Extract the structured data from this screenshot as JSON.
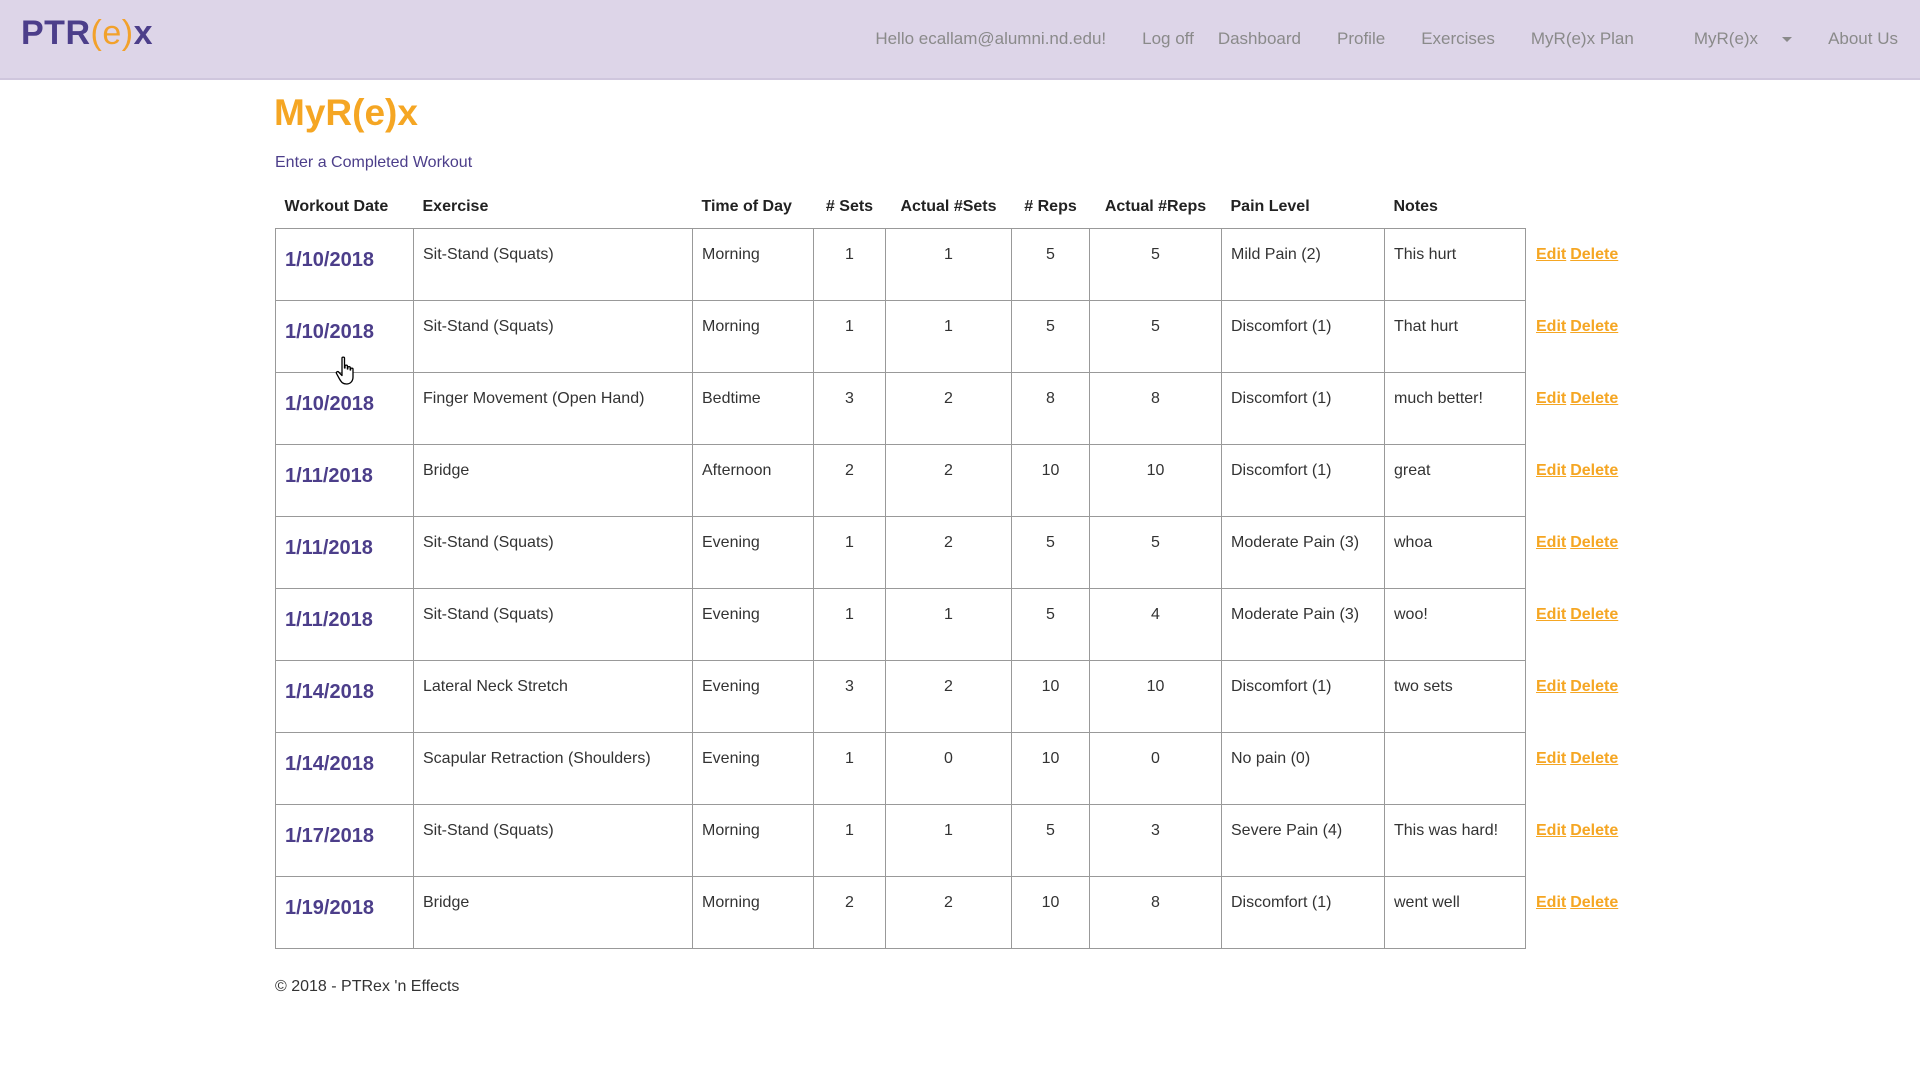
{
  "nav": {
    "brand_prefix": "PTR",
    "brand_accent": "(e)",
    "brand_suffix": "x",
    "greeting": "Hello ecallam@alumni.nd.edu!",
    "logoff": "Log off",
    "dashboard": "Dashboard",
    "profile": "Profile",
    "exercises": "Exercises",
    "plan": "MyR(e)x Plan",
    "myrex": "MyR(e)x",
    "about": "About Us"
  },
  "page": {
    "title": "MyR(e)x",
    "subtitle": "Enter a Completed Workout"
  },
  "table": {
    "headers": {
      "date": "Workout Date",
      "exercise": "Exercise",
      "time": "Time of Day",
      "sets": "# Sets",
      "actual_sets": "Actual #Sets",
      "reps": "# Reps",
      "actual_reps": "Actual #Reps",
      "pain": "Pain Level",
      "notes": "Notes"
    },
    "edit_label": "Edit",
    "delete_label": "Delete",
    "rows": [
      {
        "date": "1/10/2018",
        "exercise": "Sit-Stand (Squats)",
        "time": "Morning",
        "sets": "1",
        "actual_sets": "1",
        "reps": "5",
        "actual_reps": "5",
        "pain": "Mild Pain (2)",
        "notes": "This hurt"
      },
      {
        "date": "1/10/2018",
        "exercise": "Sit-Stand (Squats)",
        "time": "Morning",
        "sets": "1",
        "actual_sets": "1",
        "reps": "5",
        "actual_reps": "5",
        "pain": "Discomfort (1)",
        "notes": "That hurt"
      },
      {
        "date": "1/10/2018",
        "exercise": "Finger Movement (Open Hand)",
        "time": "Bedtime",
        "sets": "3",
        "actual_sets": "2",
        "reps": "8",
        "actual_reps": "8",
        "pain": "Discomfort (1)",
        "notes": "much better!"
      },
      {
        "date": "1/11/2018",
        "exercise": "Bridge",
        "time": "Afternoon",
        "sets": "2",
        "actual_sets": "2",
        "reps": "10",
        "actual_reps": "10",
        "pain": "Discomfort (1)",
        "notes": "great"
      },
      {
        "date": "1/11/2018",
        "exercise": "Sit-Stand (Squats)",
        "time": "Evening",
        "sets": "1",
        "actual_sets": "2",
        "reps": "5",
        "actual_reps": "5",
        "pain": "Moderate Pain (3)",
        "notes": "whoa"
      },
      {
        "date": "1/11/2018",
        "exercise": "Sit-Stand (Squats)",
        "time": "Evening",
        "sets": "1",
        "actual_sets": "1",
        "reps": "5",
        "actual_reps": "4",
        "pain": "Moderate Pain (3)",
        "notes": "woo!"
      },
      {
        "date": "1/14/2018",
        "exercise": "Lateral Neck Stretch",
        "time": "Evening",
        "sets": "3",
        "actual_sets": "2",
        "reps": "10",
        "actual_reps": "10",
        "pain": "Discomfort (1)",
        "notes": "two sets"
      },
      {
        "date": "1/14/2018",
        "exercise": "Scapular Retraction (Shoulders)",
        "time": "Evening",
        "sets": "1",
        "actual_sets": "0",
        "reps": "10",
        "actual_reps": "0",
        "pain": "No pain (0)",
        "notes": ""
      },
      {
        "date": "1/17/2018",
        "exercise": "Sit-Stand (Squats)",
        "time": "Morning",
        "sets": "1",
        "actual_sets": "1",
        "reps": "5",
        "actual_reps": "3",
        "pain": "Severe Pain (4)",
        "notes": "This was hard!"
      },
      {
        "date": "1/19/2018",
        "exercise": "Bridge",
        "time": "Morning",
        "sets": "2",
        "actual_sets": "2",
        "reps": "10",
        "actual_reps": "8",
        "pain": "Discomfort (1)",
        "notes": "went well"
      }
    ]
  },
  "footer": {
    "text": "© 2018 - PTRex 'n Effects"
  },
  "icons": {
    "cursor": "hand-pointer-icon",
    "dropdown": "caret-down-icon"
  },
  "colors": {
    "navbar_bg": "#ddd5e8",
    "brand_purple": "#4c3e8a",
    "accent_orange": "#f5a623"
  }
}
